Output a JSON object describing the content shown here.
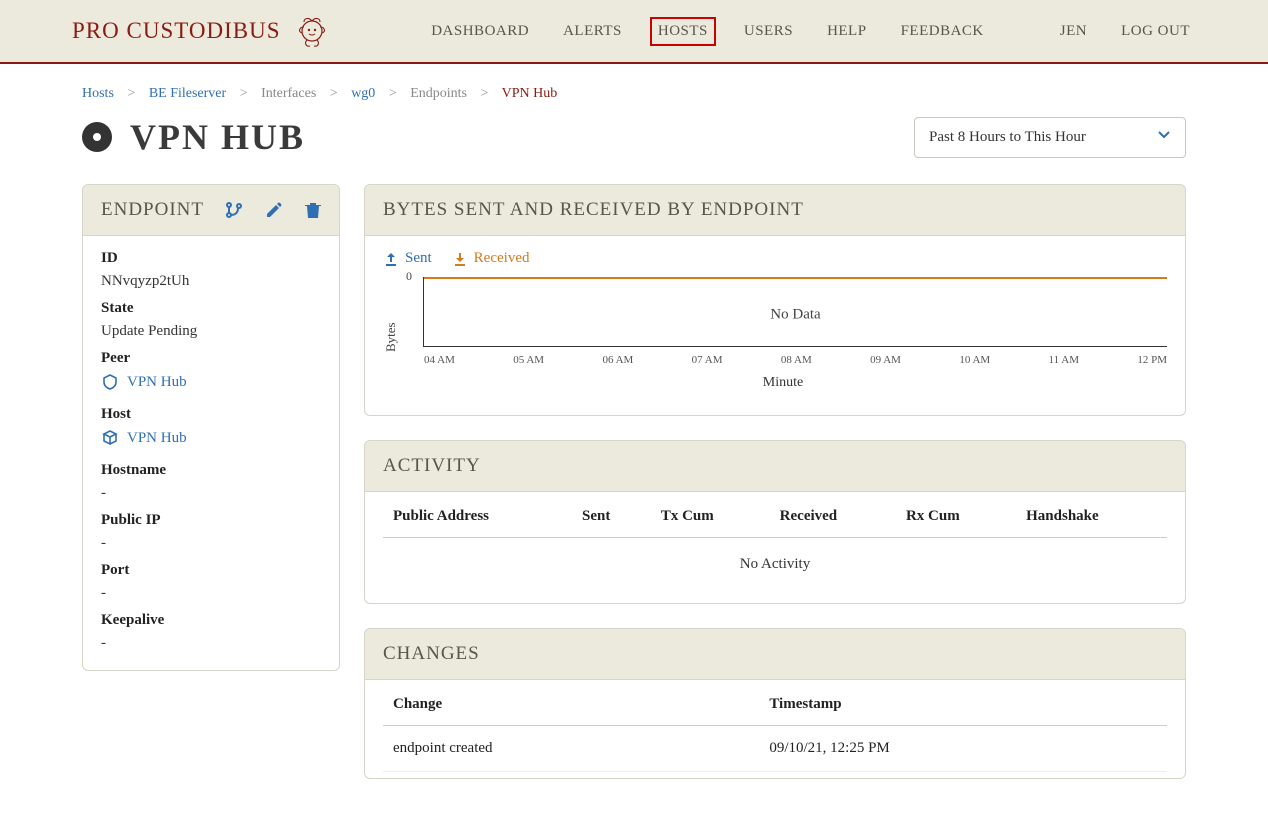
{
  "brand": "PRO CUSTODIBUS",
  "nav": {
    "dashboard": "DASHBOARD",
    "alerts": "ALERTS",
    "hosts": "HOSTS",
    "users": "USERS",
    "help": "HELP",
    "feedback": "FEEDBACK",
    "username": "JEN",
    "logout": "LOG OUT"
  },
  "breadcrumb": {
    "hosts": "Hosts",
    "host": "BE Fileserver",
    "interfaces": "Interfaces",
    "iface": "wg0",
    "endpoints": "Endpoints",
    "current": "VPN Hub"
  },
  "page": {
    "title": "VPN HUB",
    "timerange": "Past 8 Hours to This Hour"
  },
  "endpoint_panel": {
    "title": "ENDPOINT",
    "fields": {
      "id_label": "ID",
      "id_value": "NNvqyzp2tUh",
      "state_label": "State",
      "state_value": "Update Pending",
      "peer_label": "Peer",
      "peer_value": "VPN Hub",
      "host_label": "Host",
      "host_value": "VPN Hub",
      "hostname_label": "Hostname",
      "hostname_value": "-",
      "publicip_label": "Public IP",
      "publicip_value": "-",
      "port_label": "Port",
      "port_value": "-",
      "keepalive_label": "Keepalive",
      "keepalive_value": "-"
    }
  },
  "chart_panel": {
    "title": "BYTES SENT AND RECEIVED BY ENDPOINT",
    "legend_sent": "Sent",
    "legend_received": "Received",
    "no_data": "No Data",
    "ylabel": "Bytes",
    "xlabel": "Minute"
  },
  "chart_data": {
    "type": "line",
    "title": "Bytes Sent and Received by Endpoint",
    "xlabel": "Minute",
    "ylabel": "Bytes",
    "ylim": [
      0,
      0
    ],
    "categories": [
      "04 AM",
      "05 AM",
      "06 AM",
      "07 AM",
      "08 AM",
      "09 AM",
      "10 AM",
      "11 AM",
      "12 PM"
    ],
    "series": [
      {
        "name": "Sent",
        "values": [
          0,
          0,
          0,
          0,
          0,
          0,
          0,
          0,
          0
        ]
      },
      {
        "name": "Received",
        "values": [
          0,
          0,
          0,
          0,
          0,
          0,
          0,
          0,
          0
        ]
      }
    ],
    "note": "No Data"
  },
  "activity": {
    "title": "ACTIVITY",
    "columns": {
      "public_address": "Public Address",
      "sent": "Sent",
      "tx_cum": "Tx Cum",
      "received": "Received",
      "rx_cum": "Rx Cum",
      "handshake": "Handshake"
    },
    "empty": "No Activity"
  },
  "changes": {
    "title": "CHANGES",
    "columns": {
      "change": "Change",
      "timestamp": "Timestamp"
    },
    "rows": [
      {
        "change": "endpoint created",
        "timestamp": "09/10/21, 12:25 PM"
      }
    ]
  }
}
